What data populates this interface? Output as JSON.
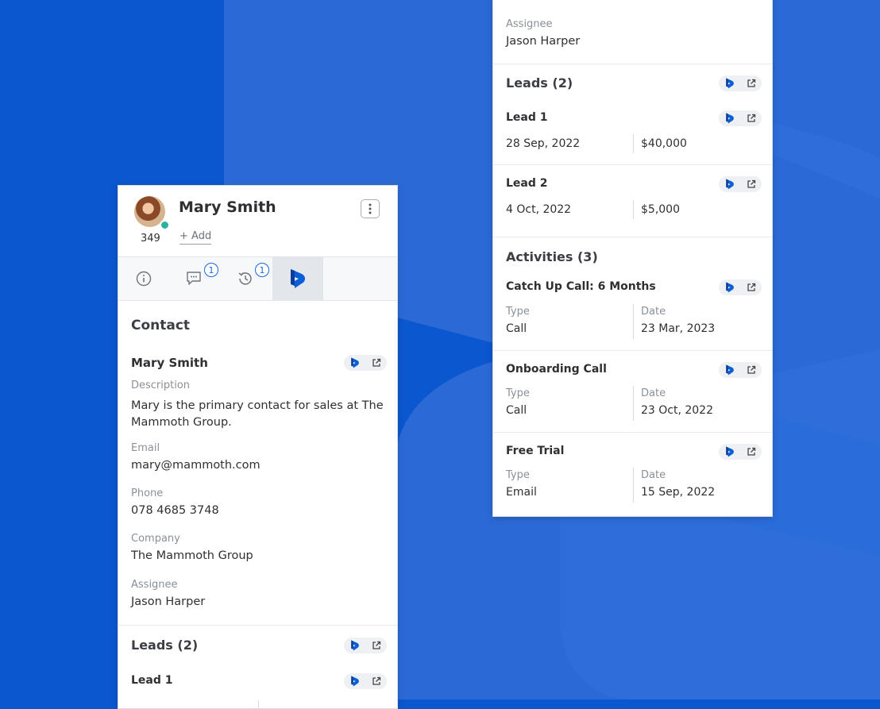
{
  "colors": {
    "background": "#0b57d0",
    "accent": "#1a66e0",
    "panel": "#ffffff"
  },
  "contact": {
    "name": "Mary Smith",
    "count": "349",
    "add_label": "+ Add",
    "tabs": [
      {
        "icon": "info-icon",
        "badge": ""
      },
      {
        "icon": "chat-icon",
        "badge": "1"
      },
      {
        "icon": "history-icon",
        "badge": "1"
      },
      {
        "icon": "dynamics-logo-icon",
        "badge": ""
      }
    ]
  },
  "left": {
    "section_title": "Contact",
    "record_name": "Mary Smith",
    "fields": [
      {
        "label": "Description",
        "value": "Mary is the primary contact for sales at The Mammoth Group."
      },
      {
        "label": "Email",
        "value": "mary@mammoth.com"
      },
      {
        "label": "Phone",
        "value": "078 4685 3748"
      },
      {
        "label": "Company",
        "value": "The Mammoth Group"
      },
      {
        "label": "Assignee",
        "value": "Jason Harper"
      }
    ],
    "leads_title": "Leads (2)",
    "lead1_title": "Lead 1"
  },
  "right": {
    "assignee_label": "Assignee",
    "assignee_value": "Jason Harper",
    "leads_title": "Leads (2)",
    "leads": [
      {
        "title": "Lead 1",
        "date": "28 Sep, 2022",
        "amount": "$40,000"
      },
      {
        "title": "Lead 2",
        "date": "4 Oct, 2022",
        "amount": "$5,000"
      }
    ],
    "activities_title": "Activities (3)",
    "activities": [
      {
        "title": "Catch Up Call: 6 Months",
        "type_label": "Type",
        "type": "Call",
        "date_label": "Date",
        "date": "23 Mar, 2023"
      },
      {
        "title": "Onboarding Call",
        "type_label": "Type",
        "type": "Call",
        "date_label": "Date",
        "date": "23 Oct, 2022"
      },
      {
        "title": "Free Trial",
        "type_label": "Type",
        "type": "Email",
        "date_label": "Date",
        "date": "15 Sep, 2022"
      }
    ]
  }
}
